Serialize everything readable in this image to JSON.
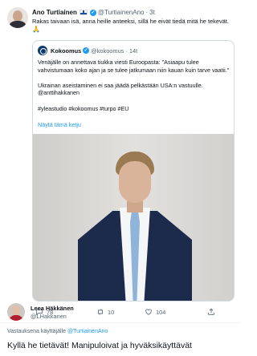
{
  "tweet": {
    "author_name": "Ano Turtiainen",
    "author_handle": "@TurtiainenAno",
    "separator": "·",
    "time": "3t",
    "text": "Rakas taivaan isä, anna heille anteeksi, sillä he eivät tiedä mitä he tekevät.",
    "emoji": "🙏",
    "icons": {
      "flag": "finland-flag-icon",
      "verified": "verified-badge-icon"
    }
  },
  "quote": {
    "author_name": "Kokoomus",
    "author_handle": "@kokoomus",
    "separator": "·",
    "time": "14t",
    "paragraph1": "Venäjälle on annettava tiukka viesti Euroopasta: \"Asiaapu tulee vahvistumaan koko ajan ja se tulee jatkumaan niin kauan kuin tarve vaatii.\"",
    "paragraph2": "Ukrainan aseistaminen ei saa jäädä pelkästään USA:n vastuulle. @anttihakkanen",
    "paragraph3": "#yleastudio #kokoomus #turpo #EU",
    "show_thread": "Näytä tämä ketju"
  },
  "actions": {
    "reply_count": "78",
    "retweet_count": "10",
    "like_count": "104",
    "icons": [
      "reply-icon",
      "retweet-icon",
      "like-icon",
      "share-icon"
    ]
  },
  "reply": {
    "author_name": "Leea Häkkänen",
    "author_handle": "@LHakkanen",
    "replying_to_prefix": "Vastauksena käyttäjälle",
    "replying_to_handle": "@TurtiainenAno",
    "text": "Kyllä he tietävät! Manipuloivat ja hyväksikäyttävät"
  },
  "colors": {
    "accent": "#1d9bf0",
    "text": "#0f1419",
    "muted": "#536471",
    "border": "#cfd9de"
  }
}
